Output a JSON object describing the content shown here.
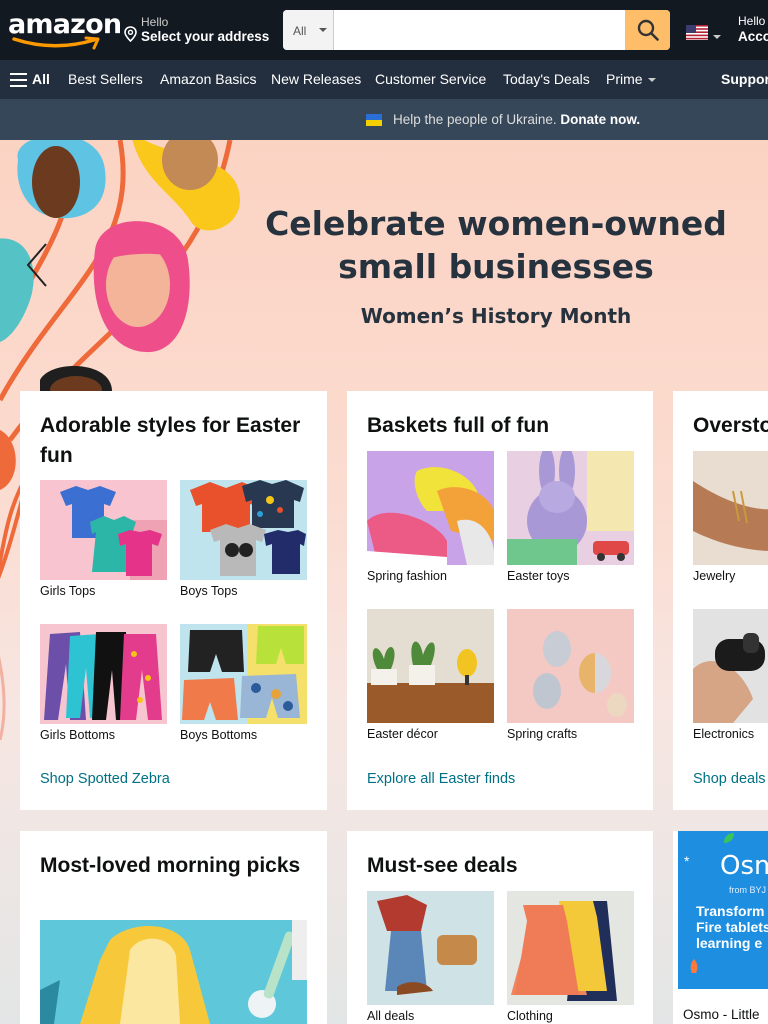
{
  "header": {
    "logo": "amazon",
    "location_greeting": "Hello",
    "location_action": "Select your address",
    "search_category": "All",
    "search_placeholder": "",
    "account_greeting": "Hello",
    "account_label": "Acco"
  },
  "nav": {
    "all_label": "All",
    "items": [
      "Best Sellers",
      "Amazon Basics",
      "New Releases",
      "Customer Service",
      "Today's Deals",
      "Prime"
    ],
    "support": "Suppor"
  },
  "ukraine": {
    "message": "Help the people of Ukraine.",
    "cta": "Donate now."
  },
  "hero": {
    "title_line1": "Celebrate women-owned",
    "title_line2": "small businesses",
    "subtitle": "Women’s History Month"
  },
  "cards": [
    {
      "title": "Adorable styles for Easter fun",
      "tiles": [
        "Girls Tops",
        "Boys Tops",
        "Girls Bottoms",
        "Boys Bottoms"
      ],
      "link": "Shop Spotted Zebra"
    },
    {
      "title": "Baskets full of fun",
      "tiles": [
        "Spring fashion",
        "Easter toys",
        "Easter décor",
        "Spring crafts"
      ],
      "link": "Explore all Easter finds"
    },
    {
      "title": "Oversto",
      "tiles": [
        "Jewelry",
        "Electronics"
      ],
      "link": "Shop deals"
    },
    {
      "title": "Most-loved morning picks"
    },
    {
      "title": "Must-see deals",
      "tiles": [
        "All deals",
        "Clothing"
      ]
    }
  ],
  "ad": {
    "brand": "Osm",
    "from": "from BYJ",
    "headline_line1": "Transform",
    "headline_line2": "Fire tablets",
    "headline_line3": "learning e",
    "caption": "Osmo - Little"
  },
  "colors": {
    "header_bg": "#131921",
    "nav_bg": "#232f3e",
    "banner_bg": "#37475a",
    "search_button": "#febd69",
    "link": "#007185",
    "ad_bg": "#1e8fe0"
  }
}
